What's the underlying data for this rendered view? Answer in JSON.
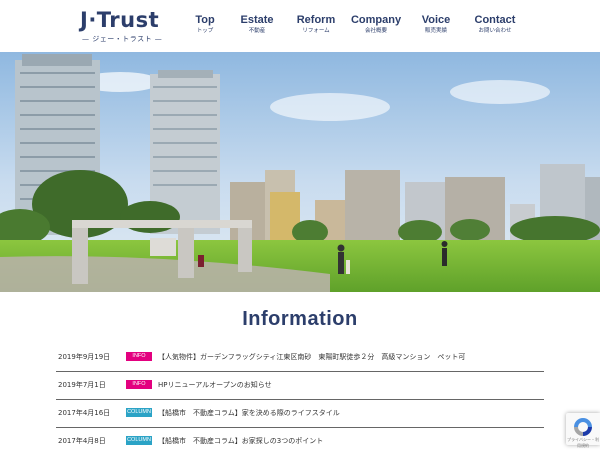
{
  "logo": {
    "main": "J·Trust",
    "sub": "— ジェー・トラスト —"
  },
  "nav": [
    {
      "en": "Top",
      "jp": "トップ"
    },
    {
      "en": "Estate",
      "jp": "不動産"
    },
    {
      "en": "Reform",
      "jp": "リフォーム"
    },
    {
      "en": "Company",
      "jp": "会社概要"
    },
    {
      "en": "Voice",
      "jp": "販売実績"
    },
    {
      "en": "Contact",
      "jp": "お問い合わせ"
    }
  ],
  "info": {
    "title": "Information",
    "items": [
      {
        "date": "2019年9月19日",
        "badge": "INFO",
        "badge_color": "#e3007f",
        "text": "【人気物件】ガーデンフラッグシティ江東区南砂　東陽町駅徒歩２分　高級マンション　ペット可"
      },
      {
        "date": "2019年7月1日",
        "badge": "INFO",
        "badge_color": "#e3007f",
        "text": "HPリニューアルオープンのお知らせ"
      },
      {
        "date": "2017年4月16日",
        "badge": "COLUMN",
        "badge_color": "#2ba3c6",
        "text": "【船橋市　不動産コラム】家を決める際のライフスタイル"
      },
      {
        "date": "2017年4月8日",
        "badge": "COLUMN",
        "badge_color": "#2ba3c6",
        "text": "【船橋市　不動産コラム】お家探しの3つのポイント"
      }
    ]
  },
  "recaptcha": {
    "label": "プライバシー・利用規約"
  },
  "colors": {
    "brand": "#2c3e6b",
    "info_badge": "#e3007f",
    "column_badge": "#2ba3c6"
  }
}
